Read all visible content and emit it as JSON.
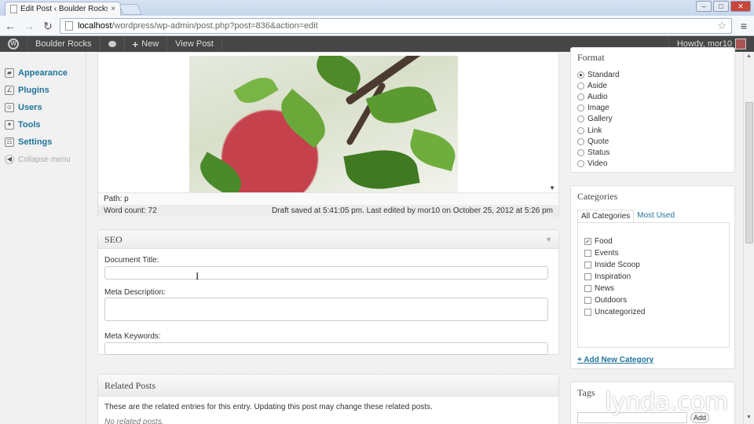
{
  "browser": {
    "tab_title": "Edit Post ‹ Boulder Rocks —",
    "tab_close": "×",
    "url_host": "localhost",
    "url_path": "/wordpress/wp-admin/post.php?post=836&action=edit",
    "window_min": "–",
    "window_max": "□",
    "window_close": "✕"
  },
  "adminbar": {
    "site_name": "Boulder Rocks",
    "new_label": "New",
    "view_post_label": "View Post",
    "howdy": "Howdy, mor10"
  },
  "adminmenu": {
    "items": [
      {
        "label": "Appearance",
        "icon": "appearance-icon"
      },
      {
        "label": "Plugins",
        "icon": "plugins-icon"
      },
      {
        "label": "Users",
        "icon": "users-icon"
      },
      {
        "label": "Tools",
        "icon": "tools-icon"
      },
      {
        "label": "Settings",
        "icon": "settings-icon"
      }
    ],
    "collapse_label": "Collapse menu"
  },
  "editor": {
    "path_label": "Path: p",
    "word_count": "Word count: 72",
    "draft_status": "Draft saved at 5:41:05 pm. Last edited by mor10 on October 25, 2012 at 5:26 pm"
  },
  "seo": {
    "title": "SEO",
    "document_title_label": "Document Title:",
    "document_title_value": "",
    "meta_description_label": "Meta Description:",
    "meta_description_value": "",
    "meta_keywords_label": "Meta Keywords:",
    "meta_keywords_value": ""
  },
  "related_posts": {
    "title": "Related Posts",
    "description": "These are the related entries for this entry. Updating this post may change these related posts.",
    "empty": "No related posts."
  },
  "format": {
    "title": "Format",
    "options": [
      "Standard",
      "Aside",
      "Audio",
      "Image",
      "Gallery",
      "Link",
      "Quote",
      "Status",
      "Video"
    ],
    "selected": "Standard"
  },
  "categories": {
    "title": "Categories",
    "tab_all": "All Categories",
    "tab_most_used": "Most Used",
    "items": [
      {
        "label": "Food",
        "checked": true
      },
      {
        "label": "Events",
        "checked": false
      },
      {
        "label": "Inside Scoop",
        "checked": false
      },
      {
        "label": "Inspiration",
        "checked": false
      },
      {
        "label": "News",
        "checked": false
      },
      {
        "label": "Outdoors",
        "checked": false
      },
      {
        "label": "Uncategorized",
        "checked": false
      }
    ],
    "add_new": "+ Add New Category"
  },
  "tags": {
    "title": "Tags",
    "add_label": "Add"
  },
  "watermark": "lynda.com",
  "colors": {
    "link": "#21759b",
    "adminbar_bg": "#464646"
  }
}
